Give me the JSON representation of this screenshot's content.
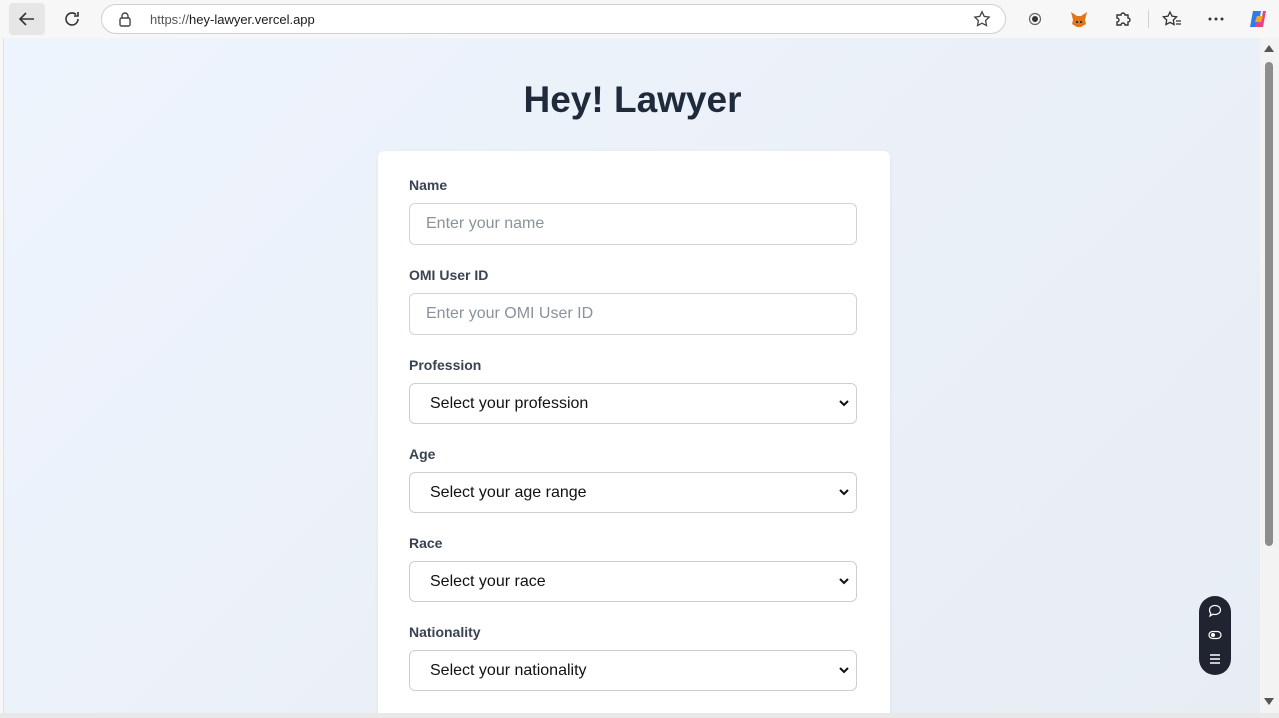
{
  "browser": {
    "url_protocol": "https://",
    "url_host": "hey-lawyer.vercel.app"
  },
  "page": {
    "title": "Hey! Lawyer"
  },
  "form": {
    "name_label": "Name",
    "name_placeholder": "Enter your name",
    "omi_label": "OMI User ID",
    "omi_placeholder": "Enter your OMI User ID",
    "profession_label": "Profession",
    "profession_value": "Select your profession",
    "age_label": "Age",
    "age_value": "Select your age range",
    "race_label": "Race",
    "race_value": "Select your race",
    "nationality_label": "Nationality",
    "nationality_value": "Select your nationality"
  },
  "icons": {
    "back": "back-arrow-icon",
    "reload": "reload-icon",
    "lock": "lock-icon",
    "favorite": "star-icon",
    "extension_record": "record-icon",
    "extension_fox": "fox-extension-icon",
    "extensions": "puzzle-icon",
    "favorites": "favorites-icon",
    "more": "more-icon",
    "copilot": "copilot-icon",
    "chat": "chat-icon",
    "toggle": "toggle-icon",
    "menu": "menu-icon"
  },
  "colors": {
    "title": "#1f2a3a",
    "card": "#ffffff",
    "widget": "#1f2430"
  }
}
